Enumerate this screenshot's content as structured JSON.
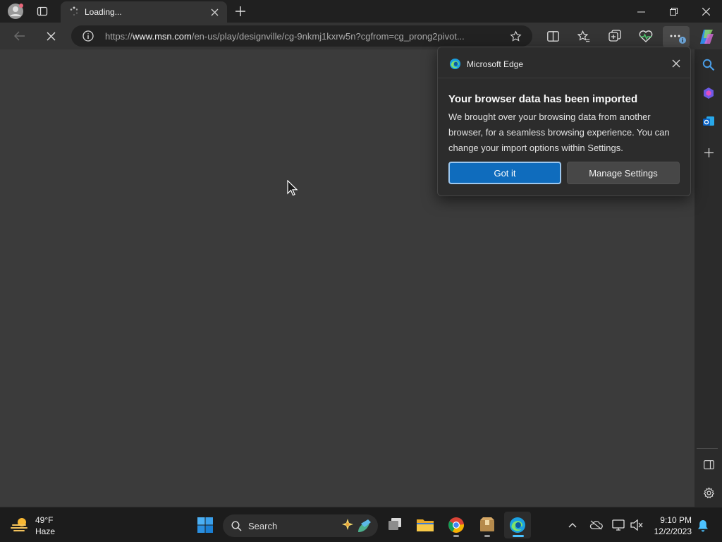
{
  "browser": {
    "tab": {
      "title": "Loading..."
    },
    "address": {
      "prefix": "https://",
      "domain": "www.msn.com",
      "path": "/en-us/play/designville/cg-9nkmj1kxrw5n?cgfrom=cg_prong2pivot..."
    }
  },
  "popup": {
    "app_name": "Microsoft Edge",
    "title": "Your browser data has been imported",
    "body": "We brought over your browsing data from another browser, for a seamless browsing experience. You can change your import options within Settings.",
    "primary_button": "Got it",
    "secondary_button": "Manage Settings"
  },
  "taskbar": {
    "weather": {
      "temp": "49°F",
      "condition": "Haze"
    },
    "search_label": "Search",
    "clock": {
      "time": "9:10 PM",
      "date": "12/2/2023"
    }
  },
  "colors": {
    "accent": "#0f6cbd",
    "active_indicator": "#4cc2ff",
    "background": "#3b3b3b"
  }
}
